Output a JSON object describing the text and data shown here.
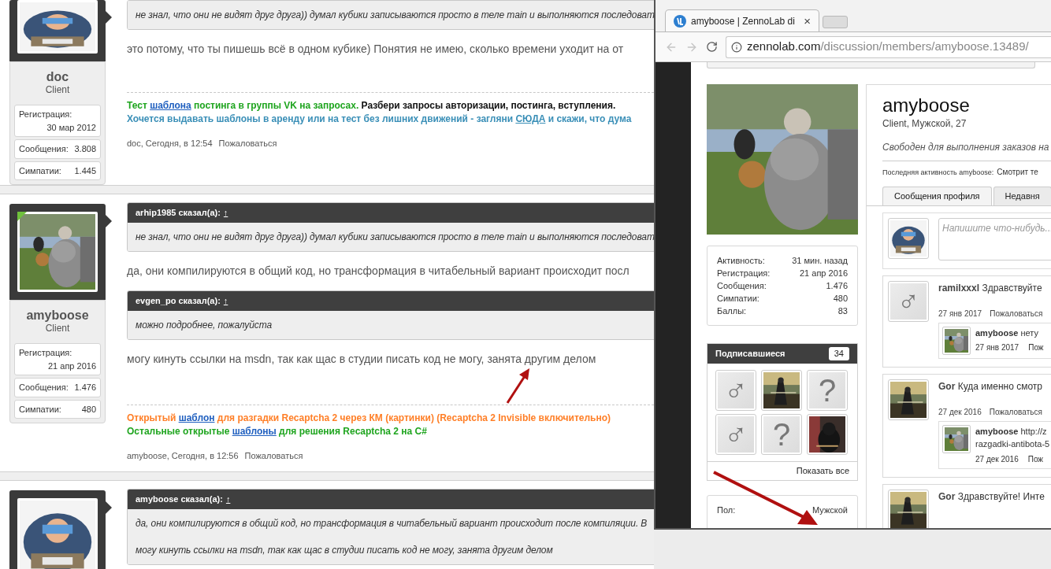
{
  "forum": {
    "posts": [
      {
        "user": {
          "name": "doc",
          "title": "Client",
          "online": false,
          "avatar": {
            "kind": "picture"
          },
          "stats": [
            {
              "kind": "stacked",
              "label": "Регистрация:",
              "value": "30 мар 2012"
            },
            {
              "kind": "inline",
              "label": "Сообщения:",
              "value": "3.808"
            },
            {
              "kind": "inline",
              "label": "Симпатии:",
              "value": "1.445"
            }
          ]
        },
        "blocks": [
          {
            "kind": "quote",
            "text": "не знал, что они не видят друг друга)) думал кубики записываются просто в теле main и выполняются последоват"
          },
          {
            "kind": "text",
            "text": "это потому, что ты пишешь всё в одном кубике) Понятия не имею, сколько времени уходит на от"
          }
        ],
        "signature": [
          [
            {
              "text": "Тест ",
              "color": "#1fa51f",
              "link": false
            },
            {
              "text": "шаблона",
              "color": "#1f5fbf",
              "link": true
            },
            {
              "text": " постинга в группы VK на запросах.",
              "color": "#1fa51f",
              "link": false
            },
            {
              "text": " Разбери запросы авторизации, постинга, вступления.",
              "color": "#111111",
              "link": false
            }
          ],
          [
            {
              "text": "Хочется выдавать шаблоны в аренду или на тест без лишних движений - загляни ",
              "color": "#3a8fb7",
              "link": false
            },
            {
              "text": "СЮДА",
              "color": "#3a8fb7",
              "link": true
            },
            {
              "text": " и скажи, что дума",
              "color": "#3a8fb7",
              "link": false
            }
          ]
        ],
        "footer": {
          "meta": "doc, Сегодня, в 12:54",
          "report": "Пожаловаться"
        }
      },
      {
        "user": {
          "name": "amyboose",
          "title": "Client",
          "online": true,
          "avatar": {
            "kind": "picture"
          },
          "stats": [
            {
              "kind": "stacked",
              "label": "Регистрация:",
              "value": "21 апр 2016"
            },
            {
              "kind": "inline",
              "label": "Сообщения:",
              "value": "1.476"
            },
            {
              "kind": "inline",
              "label": "Симпатии:",
              "value": "480"
            }
          ]
        },
        "blocks": [
          {
            "kind": "quote",
            "author": "arhip1985 сказал(а):",
            "jump": "↑",
            "text": "не знал, что они не видят друг друга)) думал кубики записываются просто в теле main и выполняются последоват"
          },
          {
            "kind": "text",
            "text": "да, они компилируются в общий код, но трансформация в читабельный вариант происходит посл"
          },
          {
            "kind": "quote",
            "author": "evgen_po сказал(а):",
            "jump": "↑",
            "text": "можно подробнее, пожалуйста"
          },
          {
            "kind": "text",
            "text": "могу кинуть ссылки на msdn, так как щас в студии писать код не могу, занята другим делом"
          }
        ],
        "signature": [
          [
            {
              "text": "Открытый ",
              "color": "#ff7f27",
              "link": false
            },
            {
              "text": "шаблон",
              "color": "#1f5fbf",
              "link": true
            },
            {
              "text": " для разгадки Recaptcha 2 через КМ (картинки) (Recaptcha 2 Invisible включительно)",
              "color": "#ff7f27",
              "link": false
            }
          ],
          [
            {
              "text": "Остальные открытые ",
              "color": "#1fa51f",
              "link": false
            },
            {
              "text": "шаблоны",
              "color": "#1f5fbf",
              "link": true
            },
            {
              "text": " для решения Recaptcha 2 на C#",
              "color": "#1fa51f",
              "link": false
            }
          ]
        ],
        "footer": {
          "meta": "amyboose, Сегодня, в 12:56",
          "report": "Пожаловаться"
        }
      },
      {
        "user": {
          "online": false,
          "avatar": {
            "kind": "picture"
          }
        },
        "blocks": [
          {
            "kind": "quote",
            "author": "amyboose сказал(а):",
            "jump": "↑",
            "text": "да, они компилируются в общий код, но трансформация в читабельный вариант происходит после компиляции. В",
            "text2": "могу кинуть ссылки на msdn, так как щас в студии писать код не могу, занята другим делом"
          }
        ]
      }
    ]
  },
  "browser": {
    "tab": {
      "title": "amyboose | ZennoLab di",
      "close": "×"
    },
    "address": {
      "host": "zennolab.com",
      "path": "/discussion/members/amyboose.13489/"
    },
    "profile": {
      "name": "amyboose",
      "subtitle": "Client, Мужской, 27",
      "status": "Свободен для выполнения заказов на",
      "activity_label": "Последняя активность amyboose:",
      "activity": "Смотрит те",
      "info": [
        {
          "label": "Активность:",
          "value": "31 мин. назад"
        },
        {
          "label": "Регистрация:",
          "value": "21 апр 2016"
        },
        {
          "label": "Сообщения:",
          "value": "1.476"
        },
        {
          "label": "Симпатии:",
          "value": "480"
        },
        {
          "label": "Баллы:",
          "value": "83"
        }
      ],
      "followers": {
        "title": "Подписавшиеся",
        "count": "34",
        "show_all": "Показать все",
        "avatars": [
          {
            "kind": "glyph",
            "glyph": "♂"
          },
          {
            "kind": "picture"
          },
          {
            "kind": "glyph",
            "glyph": "?"
          },
          {
            "kind": "glyph",
            "glyph": "♂"
          },
          {
            "kind": "glyph",
            "glyph": "?"
          },
          {
            "kind": "picture"
          }
        ]
      },
      "gender": {
        "label": "Пол:",
        "value": "Мужской"
      },
      "tabs": [
        {
          "label": "Сообщения профиля",
          "selected": true
        },
        {
          "label": "Недавня",
          "selected": false
        }
      ],
      "composer": {
        "placeholder": "Напишите что-нибудь..."
      },
      "posts": [
        {
          "author": "ramilxxxl",
          "text": "Здравствуйте",
          "avatar": {
            "kind": "glyph",
            "glyph": "♂"
          },
          "date": "27 янв 2017",
          "report": "Пожаловаться",
          "replies": [
            {
              "author": "amyboose",
              "text": "нету",
              "date": "27 янв 2017",
              "report": "Пож"
            }
          ]
        },
        {
          "author": "Gor",
          "text": "Куда именно смотр",
          "avatar": {
            "kind": "picture"
          },
          "date": "27 дек 2016",
          "report": "Пожаловаться",
          "replies": [
            {
              "author": "amyboose",
              "text": "http://z",
              "text2": "razgadki-antibota-5",
              "date": "27 дек 2016",
              "report": "Пож"
            }
          ]
        },
        {
          "author": "Gor",
          "text": "Здравствуйте! Инте",
          "avatar": {
            "kind": "picture"
          }
        }
      ]
    }
  }
}
